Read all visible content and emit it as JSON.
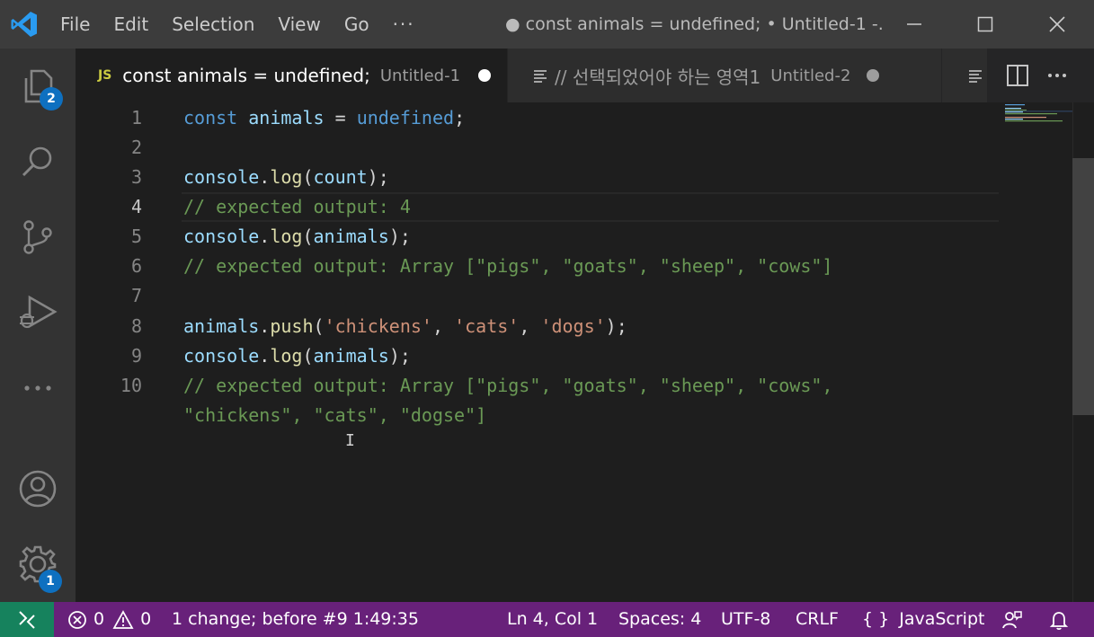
{
  "titlebar": {
    "menu": [
      "File",
      "Edit",
      "Selection",
      "View",
      "Go",
      "···"
    ],
    "window_title": "● const animals = undefined; • Untitled-1 -..."
  },
  "activity": {
    "explorer_badge": "2",
    "settings_badge": "1"
  },
  "tabs": [
    {
      "icon_text": "JS",
      "title": "const animals = undefined;",
      "description": "Untitled-1",
      "dirty": true
    },
    {
      "title": "// 선택되었어야 하는 영역1",
      "description": "Untitled-2",
      "dirty": true
    }
  ],
  "editor": {
    "line_numbers": [
      "1",
      "2",
      "3",
      "4",
      "5",
      "6",
      "7",
      "8",
      "9",
      "10"
    ],
    "current_line": "4",
    "code": {
      "l1": {
        "kw": "const",
        "var": "animals",
        "eq": " = ",
        "undef": "undefined",
        "semi": ";"
      },
      "l3": {
        "obj": "console",
        "dot": ".",
        "fn": "log",
        "open": "(",
        "arg": "count",
        "close": ");"
      },
      "l4": {
        "comment": "// expected output: 4"
      },
      "l5": {
        "obj": "console",
        "dot": ".",
        "fn": "log",
        "open": "(",
        "arg": "animals",
        "close": ");"
      },
      "l6": {
        "comment": "// expected output: Array [\"pigs\", \"goats\", \"sheep\", \"cows\"]"
      },
      "l8": {
        "obj": "animals",
        "dot": ".",
        "fn": "push",
        "open": "(",
        "s1": "'chickens'",
        "c1": ", ",
        "s2": "'cats'",
        "c2": ", ",
        "s3": "'dogs'",
        "close": ");"
      },
      "l9": {
        "obj": "console",
        "dot": ".",
        "fn": "log",
        "open": "(",
        "arg": "animals",
        "close": ");"
      },
      "l10a": {
        "comment": "// expected output: Array [\"pigs\", \"goats\", \"sheep\", \"cows\","
      },
      "l10b": {
        "comment": "\"chickens\", \"cats\", \"dogse\"]"
      }
    }
  },
  "statusbar": {
    "errors": "0",
    "warnings": "0",
    "change_info": "1 change; before #9  1:49:35",
    "position": "Ln 4, Col 1",
    "spaces": "Spaces: 4",
    "encoding": "UTF-8",
    "eol": "CRLF",
    "language_icon": "{ }",
    "language": "JavaScript"
  },
  "colors": {
    "titlebar": "#3c3c3c",
    "activitybar": "#333333",
    "editor_bg": "#1e1e1e",
    "statusbar": "#68217a",
    "remote": "#16825d",
    "badge": "#0e70c0"
  }
}
